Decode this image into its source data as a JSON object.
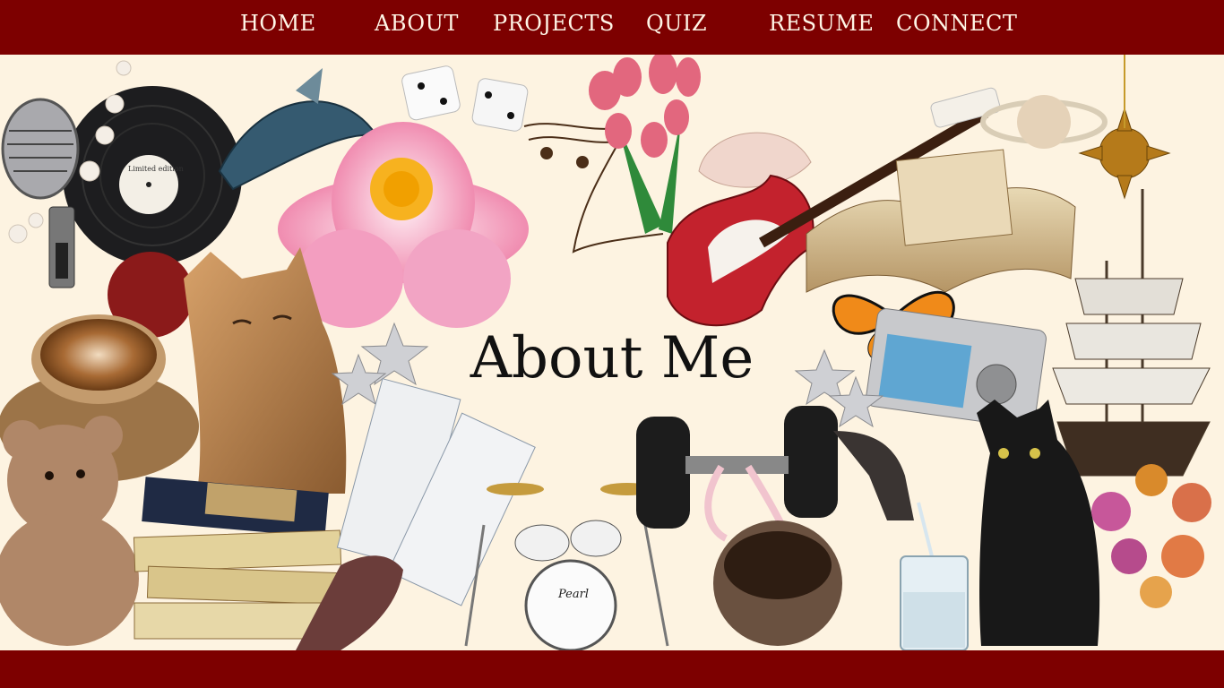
{
  "nav": {
    "items": [
      {
        "label": "HOME"
      },
      {
        "label": "ABOUT"
      },
      {
        "label": "PROJECTS"
      },
      {
        "label": "QUIZ"
      },
      {
        "label": "RESUME"
      },
      {
        "label": "CONNECT"
      }
    ]
  },
  "hero": {
    "title": "About Me",
    "record_label_text": "Limited edition",
    "drum_brand": "Pearl"
  },
  "colors": {
    "nav_bg": "#7d0000",
    "nav_text": "#fff5e6",
    "page_bg": "#fdf3e1",
    "title": "#111111"
  }
}
